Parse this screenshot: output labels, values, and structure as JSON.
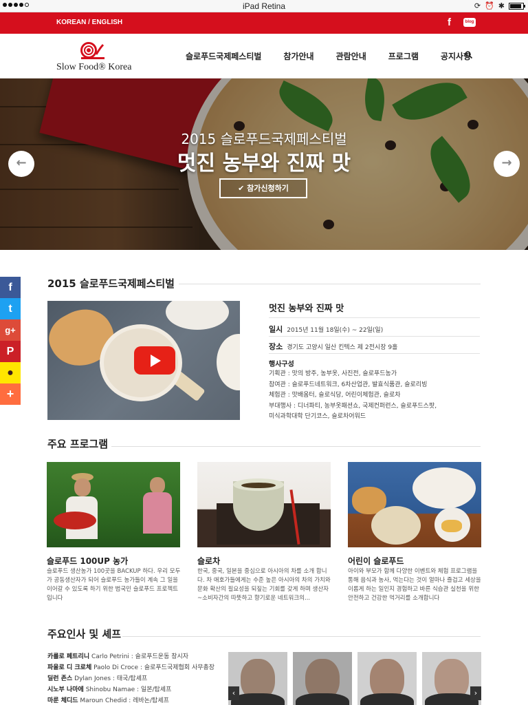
{
  "status_bar": {
    "title": "iPad Retina"
  },
  "top_strip": {
    "lang_label": "KOREAN / ENGLISH",
    "facebook_label": "f",
    "blog_label": "blog"
  },
  "header": {
    "logo_text": "Slow Food® Korea",
    "nav": [
      "슬로푸드국제페스티벌",
      "참가안내",
      "관람안내",
      "프로그램",
      "공지사항"
    ]
  },
  "hero": {
    "subtitle": "2015 슬로푸드국제페스티벌",
    "title": "멋진 농부와 진짜 맛",
    "button_label": "✔ 참가신청하기",
    "prev_label": "←",
    "next_label": "→"
  },
  "share": {
    "facebook": "f",
    "twitter": "t",
    "googleplus": "g+",
    "pinterest": "P",
    "kakao": "●",
    "more": "+"
  },
  "festival": {
    "section_title": "2015 슬로푸드국제페스티벌",
    "info_title": "멋진 농부와 진짜 맛",
    "date_label": "일시",
    "date_value": "2015년 11월 18일(수) ~ 22일(일)",
    "place_label": "장소",
    "place_value": "경기도 고양시 일산 킨텍스 제 2전시장 9홀",
    "composition_label": "행사구성",
    "composition": [
      "기획관 : 맛의 방주, 농부옷, 사진전, 슬로푸드농가",
      "참여관 : 슬로푸드네트워크, 6차산업관, 발효식품관, 슬로리빙",
      "체험관 : 맛배움터, 슬로식당, 어린이체험관, 슬로차",
      "부대행사 : 디너파티, 농부옷패션쇼, 국제컨퍼런스, 슬로푸드스팟,",
      "미식과학대학 단기코스, 슬로차어워드"
    ]
  },
  "programs": {
    "section_title": "주요 프로그램",
    "items": [
      {
        "title": "슬로푸드 100UP 농가",
        "desc": "슬로푸드 생산농가 100곳을 BACKUP 하다. 우리 모두가 공동생산자가 되어 슬로푸드 농가들이 계속 그 일을 이어갈 수 있도록 하기 위한 범국민 슬로푸드 프로젝트입니다"
      },
      {
        "title": "슬로차",
        "desc": "한국, 중국, 일본을 중심으로 아시아의 차를 소개 합니다. 차 애호가들에게는 수준 높은 아시아의 차의 가치와 문화 확산의 필요성을 되짚는 기회를 갖게 하며 생산자~소비자간의 따뜻하고 향기로운 네트워크의..."
      },
      {
        "title": "어린이 슬로푸드",
        "desc": "아이와 부모가 함께 다양한 이벤트와 체험 프로그램을 통해 음식과 농사, 먹는다는 것이 얼마나 즐겁고 세상을 이롭게 하는 일인지 경험하고 바른 식습관 실천을 위한 안전하고 건강한 먹거리를 소개합니다"
      }
    ]
  },
  "people": {
    "section_title": "주요인사 및 셰프",
    "list": [
      {
        "name": "카를로 페트리니",
        "detail": "Carlo Petrini : 슬로푸드운동 창시자"
      },
      {
        "name": "파올로 디 크로체",
        "detail": "Paolo Di Croce : 슬로푸드국제협회 사무총장"
      },
      {
        "name": "딜런 존스",
        "detail": "Dylan Jones : 태국/탑셰프"
      },
      {
        "name": "시노부 나마에",
        "detail": "Shinobu Namae : 일본/탑셰프"
      },
      {
        "name": "마룬 체디드",
        "detail": "Maroun Chedid : 레바논/탑셰프"
      }
    ],
    "prev_label": "‹",
    "next_label": "›"
  },
  "colors": {
    "brand_red": "#d50f1d",
    "youtube_red": "#e62117"
  }
}
